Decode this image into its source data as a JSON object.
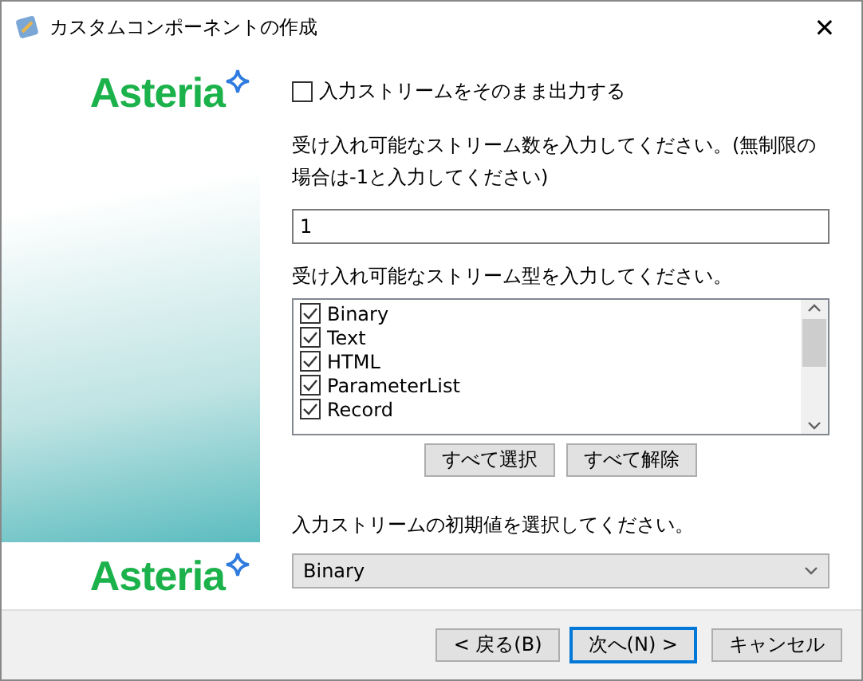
{
  "window": {
    "title": "カスタムコンポーネントの作成",
    "close": "✕"
  },
  "sidebar": {
    "logo_top": "Asteria",
    "logo_bottom": "Asteria"
  },
  "pass_through": {
    "label": "入力ストリームをそのまま出力する",
    "checked": false
  },
  "stream_count": {
    "label": "受け入れ可能なストリーム数を入力してください。(無制限の場合は-1と入力してください)",
    "value": "1"
  },
  "stream_types": {
    "label": "受け入れ可能なストリーム型を入力してください。",
    "items": [
      {
        "label": "Binary",
        "checked": true
      },
      {
        "label": "Text",
        "checked": true
      },
      {
        "label": "HTML",
        "checked": true
      },
      {
        "label": "ParameterList",
        "checked": true
      },
      {
        "label": "Record",
        "checked": true
      }
    ],
    "buttons": [
      "すべて選択",
      "すべて解除"
    ]
  },
  "initial": {
    "label": "入力ストリームの初期値を選択してください。",
    "value": "Binary"
  },
  "footer": {
    "buttons": [
      {
        "label": "< 戻る(B)",
        "selected": false
      },
      {
        "label": "次へ(N) >",
        "selected": true
      },
      {
        "label": "キャンセル",
        "selected": false
      }
    ]
  }
}
